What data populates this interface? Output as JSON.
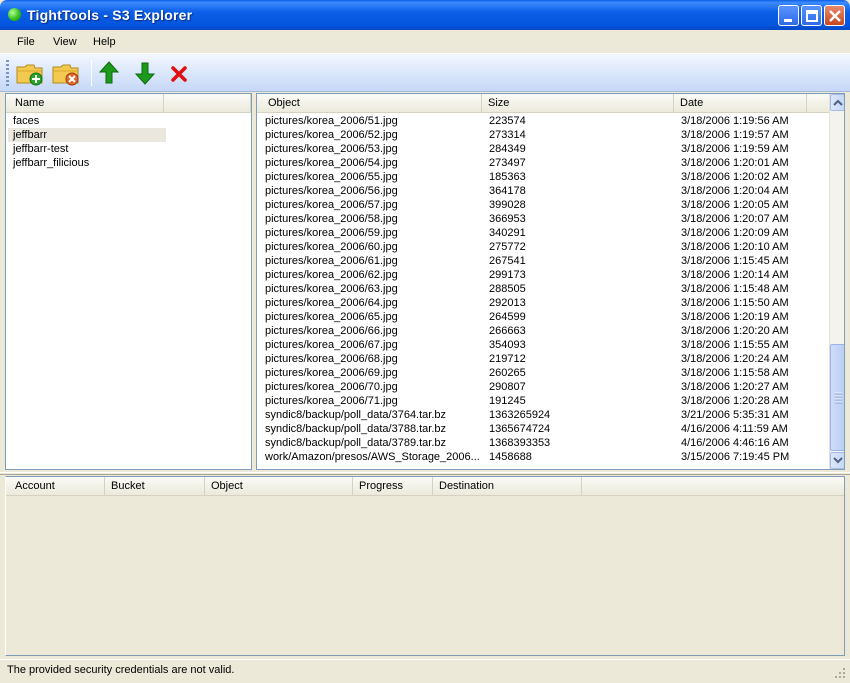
{
  "window": {
    "title": "TightTools - S3 Explorer"
  },
  "menu": {
    "items": [
      "File",
      "View",
      "Help"
    ]
  },
  "toolbar": {
    "icons": [
      "new-folder-icon",
      "delete-folder-icon",
      "upload-arrow-icon",
      "download-arrow-icon",
      "delete-x-icon"
    ]
  },
  "buckets": {
    "header": "Name",
    "items": [
      "faces",
      "jeffbarr",
      "jeffbarr-test",
      "jeffbarr_filicious"
    ],
    "selected": "jeffbarr"
  },
  "objects": {
    "columns": [
      "Object",
      "Size",
      "Date"
    ],
    "rows": [
      {
        "object": "pictures/korea_2006/51.jpg",
        "size": "223574",
        "date": "3/18/2006 1:19:56 AM"
      },
      {
        "object": "pictures/korea_2006/52.jpg",
        "size": "273314",
        "date": "3/18/2006 1:19:57 AM"
      },
      {
        "object": "pictures/korea_2006/53.jpg",
        "size": "284349",
        "date": "3/18/2006 1:19:59 AM"
      },
      {
        "object": "pictures/korea_2006/54.jpg",
        "size": "273497",
        "date": "3/18/2006 1:20:01 AM"
      },
      {
        "object": "pictures/korea_2006/55.jpg",
        "size": "185363",
        "date": "3/18/2006 1:20:02 AM"
      },
      {
        "object": "pictures/korea_2006/56.jpg",
        "size": "364178",
        "date": "3/18/2006 1:20:04 AM"
      },
      {
        "object": "pictures/korea_2006/57.jpg",
        "size": "399028",
        "date": "3/18/2006 1:20:05 AM"
      },
      {
        "object": "pictures/korea_2006/58.jpg",
        "size": "366953",
        "date": "3/18/2006 1:20:07 AM"
      },
      {
        "object": "pictures/korea_2006/59.jpg",
        "size": "340291",
        "date": "3/18/2006 1:20:09 AM"
      },
      {
        "object": "pictures/korea_2006/60.jpg",
        "size": "275772",
        "date": "3/18/2006 1:20:10 AM"
      },
      {
        "object": "pictures/korea_2006/61.jpg",
        "size": "267541",
        "date": "3/18/2006 1:15:45 AM"
      },
      {
        "object": "pictures/korea_2006/62.jpg",
        "size": "299173",
        "date": "3/18/2006 1:20:14 AM"
      },
      {
        "object": "pictures/korea_2006/63.jpg",
        "size": "288505",
        "date": "3/18/2006 1:15:48 AM"
      },
      {
        "object": "pictures/korea_2006/64.jpg",
        "size": "292013",
        "date": "3/18/2006 1:15:50 AM"
      },
      {
        "object": "pictures/korea_2006/65.jpg",
        "size": "264599",
        "date": "3/18/2006 1:20:19 AM"
      },
      {
        "object": "pictures/korea_2006/66.jpg",
        "size": "266663",
        "date": "3/18/2006 1:20:20 AM"
      },
      {
        "object": "pictures/korea_2006/67.jpg",
        "size": "354093",
        "date": "3/18/2006 1:15:55 AM"
      },
      {
        "object": "pictures/korea_2006/68.jpg",
        "size": "219712",
        "date": "3/18/2006 1:20:24 AM"
      },
      {
        "object": "pictures/korea_2006/69.jpg",
        "size": "260265",
        "date": "3/18/2006 1:15:58 AM"
      },
      {
        "object": "pictures/korea_2006/70.jpg",
        "size": "290807",
        "date": "3/18/2006 1:20:27 AM"
      },
      {
        "object": "pictures/korea_2006/71.jpg",
        "size": "191245",
        "date": "3/18/2006 1:20:28 AM"
      },
      {
        "object": "syndic8/backup/poll_data/3764.tar.bz",
        "size": "1363265924",
        "date": "3/21/2006 5:35:31 AM"
      },
      {
        "object": "syndic8/backup/poll_data/3788.tar.bz",
        "size": "1365674724",
        "date": "4/16/2006 4:11:59 AM"
      },
      {
        "object": "syndic8/backup/poll_data/3789.tar.bz",
        "size": "1368393353",
        "date": "4/16/2006 4:46:16 AM"
      },
      {
        "object": "work/Amazon/presos/AWS_Storage_2006...",
        "size": "1458688",
        "date": "3/15/2006 7:19:45 PM"
      }
    ]
  },
  "transfers": {
    "columns": [
      "Account",
      "Bucket",
      "Object",
      "Progress",
      "Destination"
    ]
  },
  "status": {
    "text": "The provided security credentials are not valid."
  },
  "colors": {
    "title_blue": "#0554de",
    "accent_green": "#1c9a1c",
    "delete_red": "#e01010",
    "folder_yellow": "#f3c94f"
  }
}
